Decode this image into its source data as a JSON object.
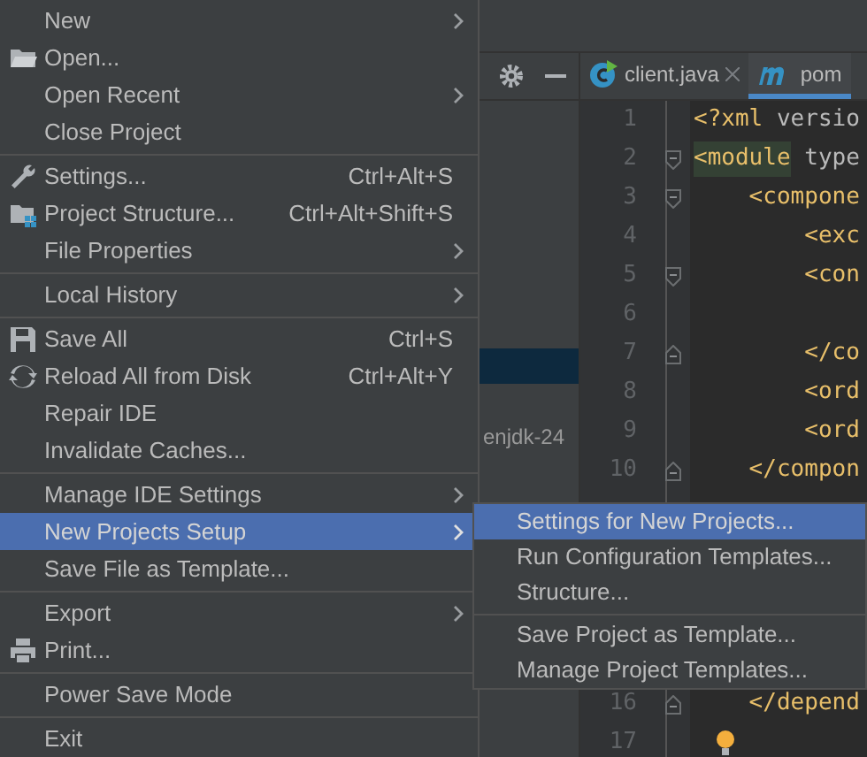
{
  "file_menu": {
    "items": [
      {
        "kind": "item",
        "label": "New",
        "submenu": true,
        "selected": false
      },
      {
        "kind": "item",
        "label": "Open...",
        "selected": false
      },
      {
        "kind": "item",
        "label": "Open Recent",
        "submenu": true,
        "selected": false
      },
      {
        "kind": "item",
        "label": "Close Project",
        "selected": false
      },
      {
        "kind": "separator"
      },
      {
        "kind": "item",
        "label": "Settings...",
        "shortcut": "Ctrl+Alt+S",
        "selected": false
      },
      {
        "kind": "item",
        "label": "Project Structure...",
        "shortcut": "Ctrl+Alt+Shift+S",
        "selected": false
      },
      {
        "kind": "item",
        "label": "File Properties",
        "submenu": true,
        "selected": false
      },
      {
        "kind": "separator"
      },
      {
        "kind": "item",
        "label": "Local History",
        "submenu": true,
        "selected": false
      },
      {
        "kind": "separator"
      },
      {
        "kind": "item",
        "label": "Save All",
        "shortcut": "Ctrl+S",
        "selected": false
      },
      {
        "kind": "item",
        "label": "Reload All from Disk",
        "shortcut": "Ctrl+Alt+Y",
        "selected": false
      },
      {
        "kind": "item",
        "label": "Repair IDE",
        "selected": false
      },
      {
        "kind": "item",
        "label": "Invalidate Caches...",
        "selected": false
      },
      {
        "kind": "separator"
      },
      {
        "kind": "item",
        "label": "Manage IDE Settings",
        "submenu": true,
        "selected": false
      },
      {
        "kind": "item",
        "label": "New Projects Setup",
        "submenu": true,
        "selected": true
      },
      {
        "kind": "item",
        "label": "Save File as Template...",
        "selected": false
      },
      {
        "kind": "separator"
      },
      {
        "kind": "item",
        "label": "Export",
        "submenu": true,
        "selected": false
      },
      {
        "kind": "item",
        "label": "Print...",
        "selected": false
      },
      {
        "kind": "separator"
      },
      {
        "kind": "item",
        "label": "Power Save Mode",
        "selected": false
      },
      {
        "kind": "separator"
      },
      {
        "kind": "item",
        "label": "Exit",
        "selected": false
      }
    ]
  },
  "submenu": {
    "items": [
      {
        "kind": "item",
        "label": "Settings for New Projects...",
        "selected": true
      },
      {
        "kind": "item",
        "label": "Run Configuration Templates...",
        "selected": false
      },
      {
        "kind": "item",
        "label": "Structure...",
        "selected": false
      },
      {
        "kind": "separator"
      },
      {
        "kind": "item",
        "label": "Save Project as Template...",
        "selected": false
      },
      {
        "kind": "item",
        "label": "Manage Project Templates...",
        "selected": false
      }
    ]
  },
  "project_panel": {
    "row_text": "enjdk-24"
  },
  "editor_tabs": [
    {
      "label": "client.java",
      "selected": false
    },
    {
      "label": "pom",
      "selected": true
    }
  ],
  "editor": {
    "lines": [
      {
        "number": "1",
        "tag": "<?xml",
        "rest": " versio"
      },
      {
        "number": "2",
        "tag": "<module",
        "rest": " type",
        "highlighted": true,
        "fold_start": true
      },
      {
        "number": "3",
        "tag": "    <compone",
        "fold_start": true
      },
      {
        "number": "4",
        "tag": "        <exc"
      },
      {
        "number": "5",
        "tag": "        <con",
        "fold_start": true
      },
      {
        "number": "6"
      },
      {
        "number": "7",
        "tag": "        </co",
        "fold_end": true
      },
      {
        "number": "8",
        "tag": "        <ord"
      },
      {
        "number": "9",
        "tag": "        <ord"
      },
      {
        "number": "10",
        "tag": "    </compon",
        "fold_end": true
      },
      {
        "number": "16",
        "tag": "    </depend",
        "fold_end": true
      },
      {
        "number": "17",
        "bulb": true
      }
    ]
  }
}
